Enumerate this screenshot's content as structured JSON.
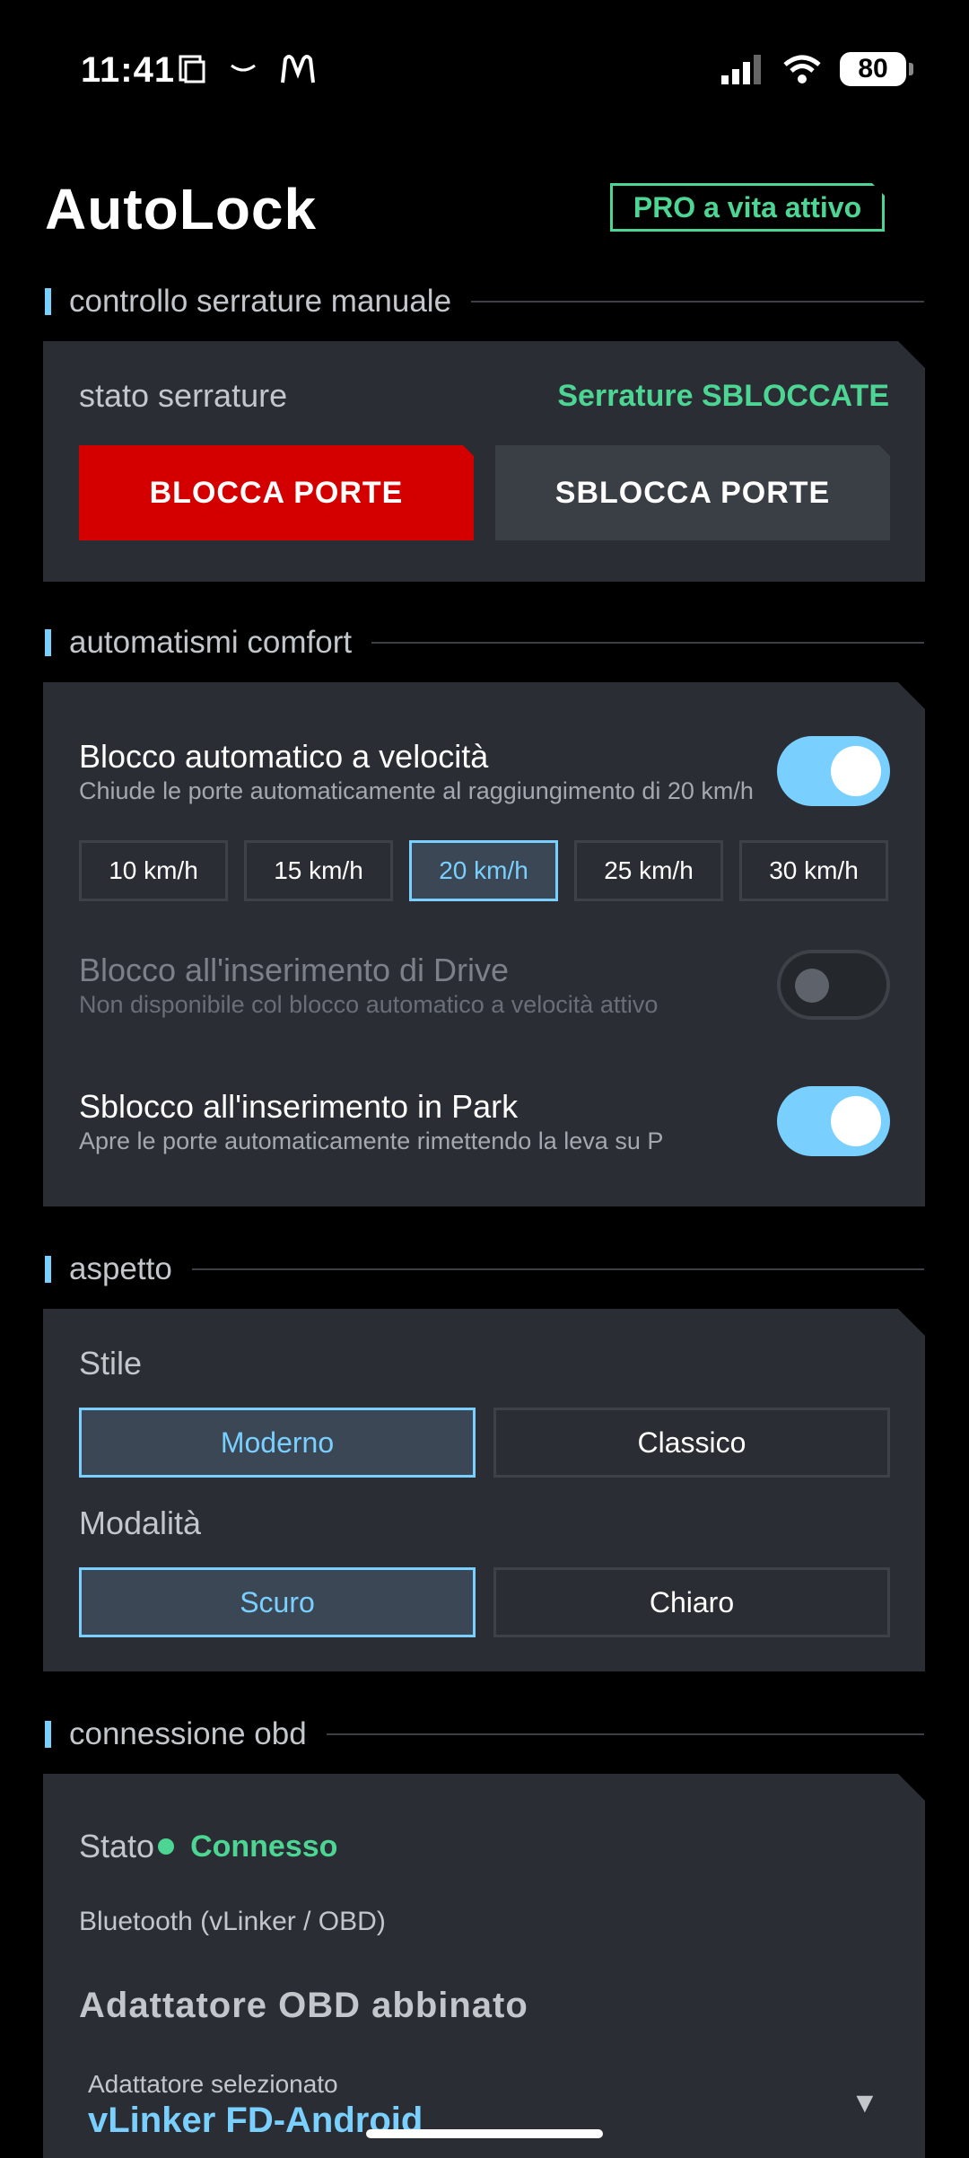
{
  "status_bar": {
    "time": "11:41",
    "battery": "80"
  },
  "header": {
    "title": "AutoLock",
    "pro_badge": "PRO a vita attivo"
  },
  "manual_section": {
    "heading": "controllo serrature manuale",
    "status_label": "stato serrature",
    "status_value": "Serrature SBLOCCATE",
    "lock_button": "BLOCCA PORTE",
    "unlock_button": "SBLOCCA PORTE"
  },
  "comfort_section": {
    "heading": "automatismi comfort",
    "speed_lock": {
      "title": "Blocco automatico a velocità",
      "subtitle": "Chiude le porte automaticamente al raggiungimento di 20 km/h",
      "enabled": true
    },
    "speed_options": [
      "10 km/h",
      "15 km/h",
      "20 km/h",
      "25 km/h",
      "30 km/h"
    ],
    "speed_selected": "20 km/h",
    "drive_lock": {
      "title": "Blocco all'inserimento di Drive",
      "subtitle": "Non disponibile col blocco automatico a velocità attivo",
      "enabled": false
    },
    "park_unlock": {
      "title": "Sblocco all'inserimento in Park",
      "subtitle": "Apre le porte automaticamente rimettendo la leva su P",
      "enabled": true
    }
  },
  "appearance_section": {
    "heading": "aspetto",
    "style_label": "Stile",
    "style_options": [
      "Moderno",
      "Classico"
    ],
    "style_selected": "Moderno",
    "mode_label": "Modalità",
    "mode_options": [
      "Scuro",
      "Chiaro"
    ],
    "mode_selected": "Scuro"
  },
  "obd_section": {
    "heading": "connessione obd",
    "stato_label": "Stato",
    "stato_value": "Connesso",
    "connection_type": "Bluetooth (vLinker / OBD)",
    "adapter_heading": "Adattatore OBD abbinato",
    "selected_label": "Adattatore selezionato",
    "selected_value": "vLinker FD-Android",
    "dropdown_icon": "▼"
  },
  "colors": {
    "accent": "#79d0ff",
    "success": "#4cd593",
    "danger": "#d40000",
    "card": "#2a2d33",
    "background": "#000000"
  }
}
